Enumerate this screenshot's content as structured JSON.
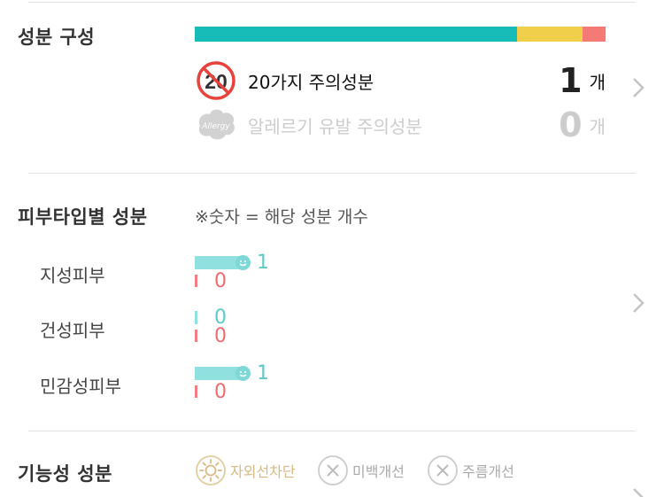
{
  "composition": {
    "title": "성분 구성",
    "bar": [
      {
        "name": "safe",
        "fraction": 0.785,
        "color": "#17bcb8"
      },
      {
        "name": "caution",
        "fraction": 0.16,
        "color": "#f0cf4a"
      },
      {
        "name": "warning",
        "fraction": 0.055,
        "color": "#f47a75"
      }
    ],
    "rows": [
      {
        "icon": "no-20-icon",
        "icon_text": "20",
        "label": "20가지 주의성분",
        "count": "1",
        "unit": "개"
      },
      {
        "icon": "allergy-icon",
        "icon_text": "Allergy",
        "label": "알레르기 유발 주의성분",
        "count": "0",
        "unit": "개"
      }
    ]
  },
  "skin_type": {
    "title": "피부타입별 성분",
    "note": "※숫자 = 해당 성분 개수",
    "items": [
      {
        "label": "지성피부",
        "good": "1",
        "bad": "0",
        "good_fraction": 0.15
      },
      {
        "label": "건성피부",
        "good": "0",
        "bad": "0",
        "good_fraction": 0
      },
      {
        "label": "민감성피부",
        "good": "1",
        "bad": "0",
        "good_fraction": 0.15
      }
    ]
  },
  "functional": {
    "title": "기능성 성분",
    "items": [
      {
        "label": "자외선차단",
        "icon": "sun-icon",
        "active": true
      },
      {
        "label": "미백개선",
        "icon": "x-circle-icon",
        "active": false
      },
      {
        "label": "주름개선",
        "icon": "x-circle-icon",
        "active": false
      }
    ]
  },
  "colors": {
    "accent_teal": "#17bcb8",
    "skin_good": "#8fe0df",
    "skin_bad": "#f27d82",
    "active_function": "#d8b982",
    "inactive_function": "#bbbbbb"
  }
}
